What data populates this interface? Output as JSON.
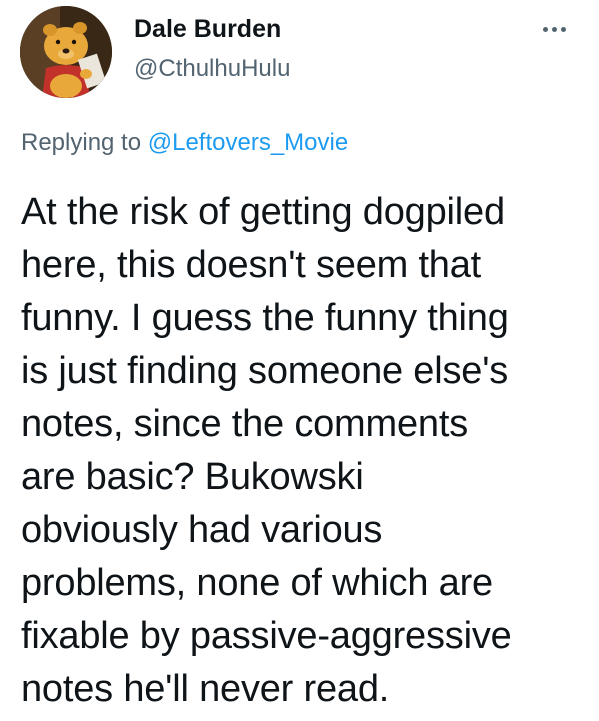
{
  "author": {
    "display_name": "Dale Burden",
    "handle": "@CthulhuHulu"
  },
  "reply": {
    "prefix": "Replying to",
    "mention": "@Leftovers_Movie"
  },
  "tweet": {
    "lines": [
      "At the risk of getting dogpiled",
      "here, this doesn't seem that",
      "funny. I guess the funny thing",
      "is just finding someone else's",
      "notes, since the comments",
      "are basic? Bukowski",
      "obviously had various",
      "problems, none of which are",
      "fixable by passive-aggressive",
      "notes he'll never read."
    ]
  },
  "icons": {
    "more": "more-horizontal-icon",
    "avatar": "avatar-image"
  },
  "colors": {
    "text": "#0f1419",
    "secondary": "#536471",
    "link": "#1d9bf0"
  }
}
